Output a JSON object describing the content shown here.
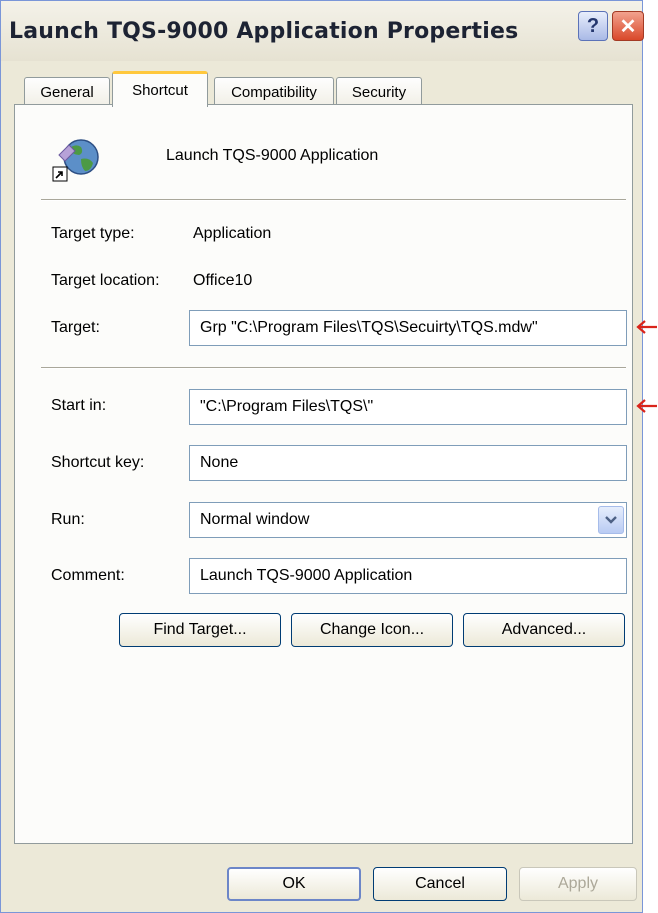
{
  "window": {
    "title": "Launch TQS-9000 Application Properties",
    "help_button": "?",
    "close_button": "✕"
  },
  "tabs": [
    {
      "label": "General"
    },
    {
      "label": "Shortcut"
    },
    {
      "label": "Compatibility"
    },
    {
      "label": "Security"
    }
  ],
  "shortcut": {
    "name": "Launch TQS-9000 Application",
    "target_type_label": "Target type:",
    "target_type_value": "Application",
    "target_location_label": "Target location:",
    "target_location_value": "Office10",
    "target_label": "Target:",
    "target_value": "Grp \"C:\\Program Files\\TQS\\Secuirty\\TQS.mdw\"",
    "start_in_label": "Start in:",
    "start_in_value": "\"C:\\Program Files\\TQS\\\"",
    "shortcut_key_label": "Shortcut key:",
    "shortcut_key_value": "None",
    "run_label": "Run:",
    "run_value": "Normal window",
    "comment_label": "Comment:",
    "comment_value": "Launch TQS-9000 Application"
  },
  "actions": {
    "find_target": "Find Target...",
    "change_icon": "Change Icon...",
    "advanced": "Advanced..."
  },
  "footer": {
    "ok": "OK",
    "cancel": "Cancel",
    "apply": "Apply"
  },
  "colors": {
    "annotation_arrow": "#d9241b",
    "active_tab_accent": "#ffc83c"
  },
  "icons": {
    "app": "globe-shortcut-icon",
    "dropdown": "chevron-down-icon"
  }
}
